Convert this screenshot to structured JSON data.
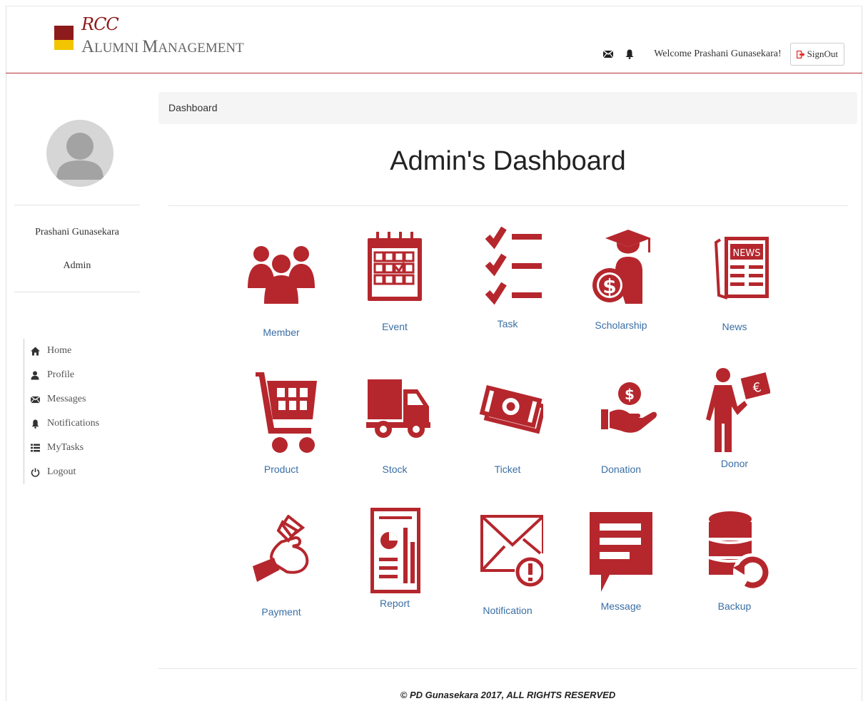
{
  "brand": {
    "logo_mark": "RCC",
    "name_first_big": "A",
    "name_first_small": "LUMNI ",
    "name_second_big": "M",
    "name_second_small": "ANAGEMENT"
  },
  "header": {
    "welcome_text": "Welcome Prashani Gunasekara!",
    "signout_label": "SignOut",
    "icons": [
      "envelope-icon",
      "bell-icon"
    ]
  },
  "user": {
    "name": "Prashani Gunasekara",
    "role": "Admin"
  },
  "nav": {
    "items": [
      {
        "label": "Home",
        "icon": "home-icon"
      },
      {
        "label": "Profile",
        "icon": "user-icon"
      },
      {
        "label": "Messages",
        "icon": "envelope-icon"
      },
      {
        "label": "Notifications",
        "icon": "bell-icon"
      },
      {
        "label": "MyTasks",
        "icon": "list-icon"
      },
      {
        "label": "Logout",
        "icon": "power-icon"
      }
    ]
  },
  "breadcrumb": "Dashboard",
  "page_title": "Admin's Dashboard",
  "tiles": [
    {
      "label": "Member",
      "icon": "group-icon"
    },
    {
      "label": "Event",
      "icon": "calendar-icon"
    },
    {
      "label": "Task",
      "icon": "checklist-icon"
    },
    {
      "label": "Scholarship",
      "icon": "graduate-icon"
    },
    {
      "label": "News",
      "icon": "newspaper-icon"
    },
    {
      "label": "Product",
      "icon": "cart-icon"
    },
    {
      "label": "Stock",
      "icon": "truck-icon"
    },
    {
      "label": "Ticket",
      "icon": "ticket-icon"
    },
    {
      "label": "Donation",
      "icon": "donation-hand-icon"
    },
    {
      "label": "Donor",
      "icon": "donor-icon"
    },
    {
      "label": "Payment",
      "icon": "payment-hand-icon"
    },
    {
      "label": "Report",
      "icon": "report-icon"
    },
    {
      "label": "Notification",
      "icon": "mail-alert-icon"
    },
    {
      "label": "Message",
      "icon": "message-bubble-icon"
    },
    {
      "label": "Backup",
      "icon": "database-backup-icon"
    }
  ],
  "colors": {
    "icon_red": "#b5272d",
    "accent_line": "#b8333a",
    "link_blue": "#3a6ea5"
  },
  "footer": "© PD Gunasekara 2017, ALL RIGHTS RESERVED"
}
